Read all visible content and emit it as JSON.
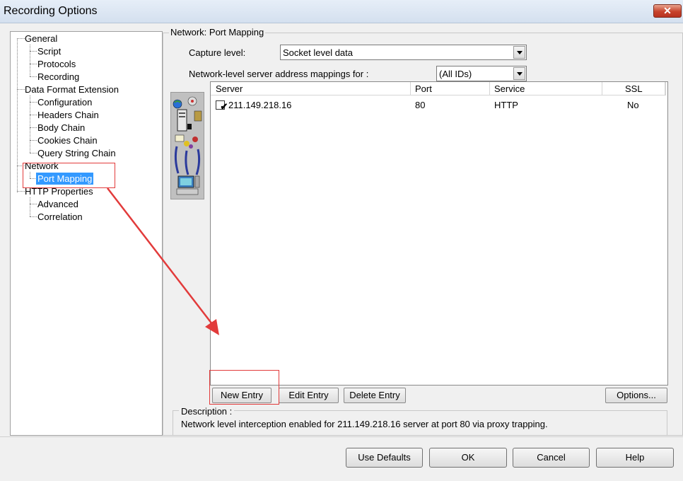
{
  "window": {
    "title": "Recording Options",
    "close_glyph": "✕"
  },
  "tree": {
    "items": [
      {
        "label": "General",
        "level": 0
      },
      {
        "label": "Script",
        "level": 1
      },
      {
        "label": "Protocols",
        "level": 1
      },
      {
        "label": "Recording",
        "level": 1
      },
      {
        "label": "Data Format Extension",
        "level": 0
      },
      {
        "label": "Configuration",
        "level": 1
      },
      {
        "label": "Headers Chain",
        "level": 1
      },
      {
        "label": "Body Chain",
        "level": 1
      },
      {
        "label": "Cookies Chain",
        "level": 1
      },
      {
        "label": "Query String Chain",
        "level": 1
      },
      {
        "label": "Network",
        "level": 0
      },
      {
        "label": "Port Mapping",
        "level": 1,
        "selected": true
      },
      {
        "label": "HTTP Properties",
        "level": 0
      },
      {
        "label": "Advanced",
        "level": 1
      },
      {
        "label": "Correlation",
        "level": 1
      }
    ]
  },
  "panel": {
    "title": "Network: Port Mapping",
    "capture_label": "Capture level:",
    "capture_value": "Socket level data",
    "mapping_label": "Network-level server address mappings for :",
    "mapping_value": "(All IDs)"
  },
  "table": {
    "columns": [
      "Server",
      "Port",
      "Service",
      "SSL"
    ],
    "rows": [
      {
        "checked": true,
        "check_glyph": "✔",
        "server": "211.149.218.16",
        "port": "80",
        "service": "HTTP",
        "ssl": "No"
      }
    ]
  },
  "buttons": {
    "new_entry": "New Entry",
    "edit_entry": "Edit Entry",
    "delete_entry": "Delete Entry",
    "options": "Options...",
    "use_defaults": "Use Defaults",
    "ok": "OK",
    "cancel": "Cancel",
    "help": "Help"
  },
  "description": {
    "title": "Description :",
    "text": "Network level interception enabled for 211.149.218.16 server at port 80 via proxy trapping."
  },
  "colors": {
    "selection": "#3399ff",
    "annotation": "#e23b3b"
  }
}
